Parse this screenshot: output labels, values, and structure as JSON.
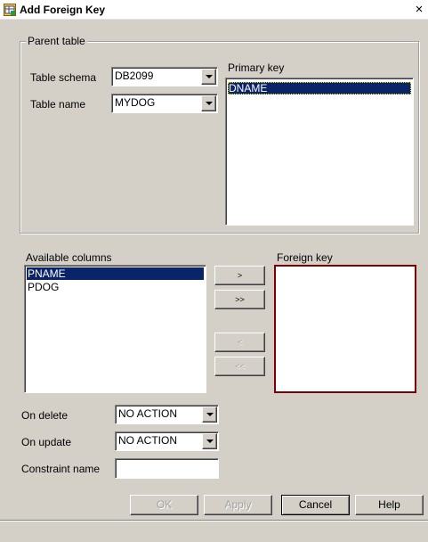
{
  "window": {
    "title": "Add Foreign Key",
    "close_glyph": "×"
  },
  "parent_table": {
    "legend": "Parent table",
    "schema_label": "Table schema",
    "schema_value": "DB2099",
    "name_label": "Table name",
    "name_value": "MYDOG",
    "primary_key_label": "Primary key",
    "primary_key_items": [
      "DNAME"
    ]
  },
  "available_columns": {
    "label": "Available columns",
    "items": [
      "PNAME",
      "PDOG"
    ],
    "selected": "PNAME"
  },
  "foreign_key": {
    "label": "Foreign key",
    "items": []
  },
  "move_buttons": {
    "add": ">",
    "add_all": ">>",
    "remove": "<",
    "remove_all": "<<"
  },
  "on_delete": {
    "label": "On delete",
    "value": "NO ACTION"
  },
  "on_update": {
    "label": "On update",
    "value": "NO ACTION"
  },
  "constraint_name": {
    "label": "Constraint name",
    "value": ""
  },
  "buttons": {
    "ok": "OK",
    "apply": "Apply",
    "cancel": "Cancel",
    "help": "Help"
  },
  "icons": {
    "title_icon": "db-table-icon",
    "dropdown": "chevron-down-icon"
  },
  "colors": {
    "selection": "#0a246a",
    "dialog_bg": "#d4d0c8",
    "focus_border": "#800000"
  }
}
